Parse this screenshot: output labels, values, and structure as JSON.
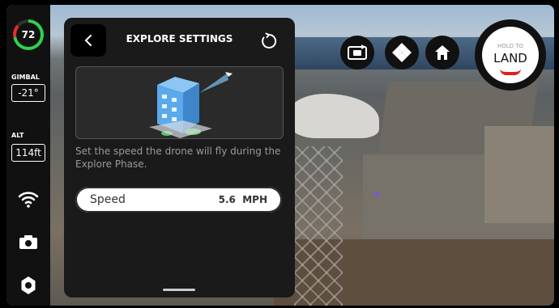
{
  "battery": {
    "percent": "72"
  },
  "gimbal": {
    "label": "GIMBAL",
    "value": "-21°"
  },
  "altitude": {
    "label": "ALT",
    "value": "114ft"
  },
  "panel": {
    "title": "EXPLORE SETTINGS",
    "description": "Set the speed the drone will fly during the Explore Phase.",
    "speed_label": "Speed",
    "speed_value": "5.6  MPH"
  },
  "land_button": {
    "hint": "HOLD TO",
    "label": "LAND"
  },
  "colors": {
    "battery_ok": "#2fd24c",
    "battery_low": "#e03030",
    "land_arrow": "#e02020"
  },
  "icons": [
    "wifi-icon",
    "camera-icon",
    "gear-icon",
    "back-icon",
    "reset-icon",
    "camera-switch-icon",
    "direction-pad-icon",
    "home-icon"
  ]
}
